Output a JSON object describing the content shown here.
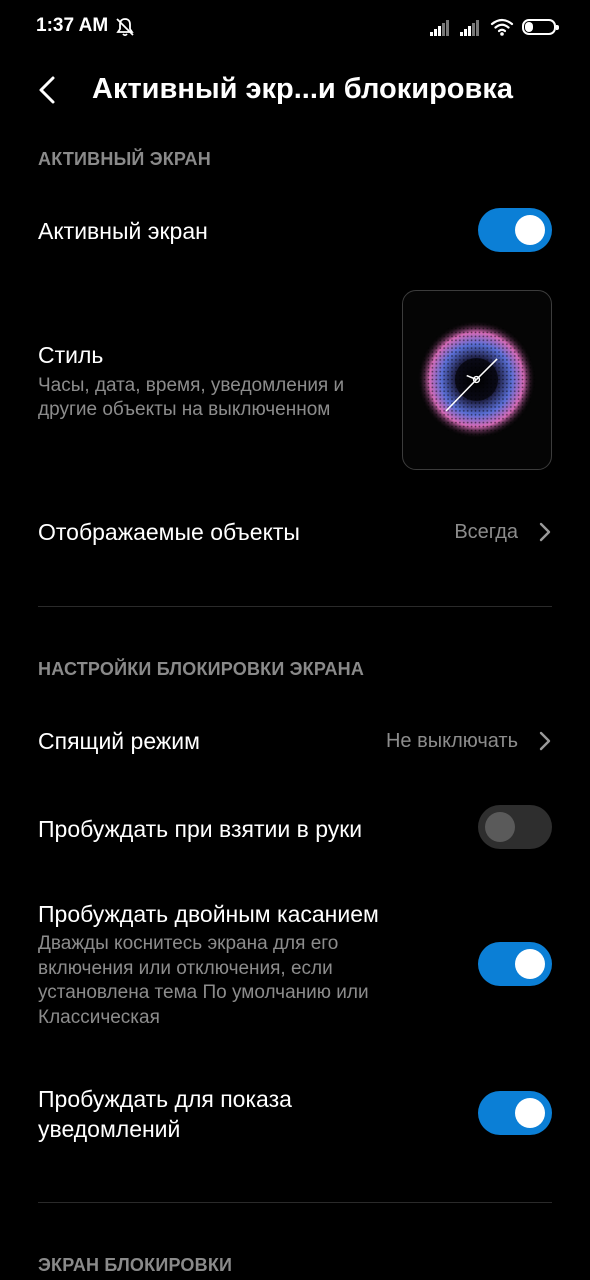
{
  "status_bar": {
    "time": "1:37 AM",
    "battery_level": "27",
    "battery_fraction": 0.27,
    "icons": [
      "bell-off-icon",
      "signal-icon",
      "signal-icon",
      "wifi-icon",
      "battery-icon"
    ]
  },
  "header": {
    "back_icon": "chevron-left-icon",
    "title": "Активный экр...и блокировка"
  },
  "section_active": {
    "header": "АКТИВНЫЙ ЭКРАН",
    "active_screen": {
      "title": "Активный экран",
      "enabled": true
    },
    "style": {
      "title": "Стиль",
      "subtitle_line1": "Часы, дата, время, уведомления и",
      "subtitle_line2": "другие объекты на выключенном",
      "preview": "analog-clock-dots-preview"
    },
    "displayed_objects": {
      "title": "Отображаемые объекты",
      "value": "Всегда"
    }
  },
  "section_lock": {
    "header": "НАСТРОЙКИ БЛОКИРОВКИ ЭКРАНА",
    "sleep": {
      "title": "Спящий режим",
      "value": "Не выключать"
    },
    "wake_pickup": {
      "title": "Пробуждать при взятии в руки",
      "enabled": false
    },
    "wake_double_tap": {
      "title": "Пробуждать двойным касанием",
      "subtitle_line1": "Дважды коснитесь экрана для его",
      "subtitle_line2": "включения или отключения, если",
      "subtitle_line3": "установлена тема По умолчанию или",
      "subtitle_line4": "Классическая",
      "enabled": true
    },
    "wake_notifications": {
      "title_line1": "Пробуждать для показа",
      "title_line2": "уведомлений",
      "enabled": true
    }
  },
  "section_lockscreen": {
    "header": "ЭКРАН БЛОКИРОВКИ"
  },
  "colors": {
    "background": "#000000",
    "accent": "#0b7fd6",
    "secondary_text": "#8c8c8c",
    "section_header": "#8a8a8a"
  }
}
